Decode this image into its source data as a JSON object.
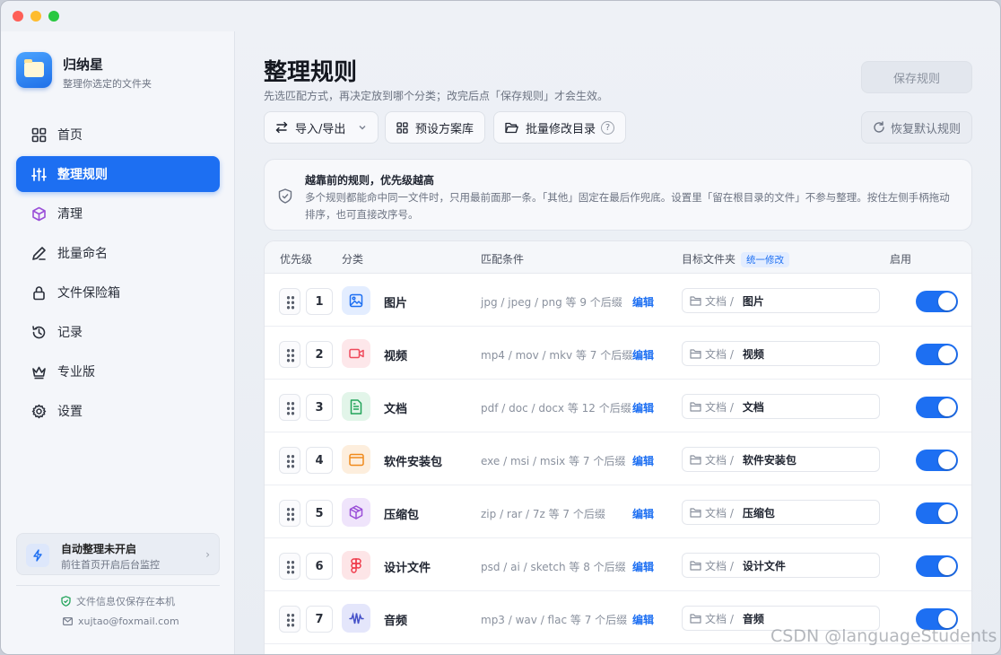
{
  "app": {
    "name": "归纳星",
    "subtitle": "整理你选定的文件夹"
  },
  "sidebar": {
    "items": [
      {
        "label": "首页",
        "icon": "grid-icon",
        "active": false
      },
      {
        "label": "整理规则",
        "icon": "sliders-icon",
        "active": true
      },
      {
        "label": "清理",
        "icon": "cube-icon",
        "active": false
      },
      {
        "label": "批量命名",
        "icon": "pen-icon",
        "active": false
      },
      {
        "label": "文件保险箱",
        "icon": "lock-icon",
        "active": false
      },
      {
        "label": "记录",
        "icon": "history-icon",
        "active": false
      },
      {
        "label": "专业版",
        "icon": "crown-icon",
        "active": false
      },
      {
        "label": "设置",
        "icon": "gear-icon",
        "active": false
      }
    ],
    "auto": {
      "title": "自动整理未开启",
      "subtitle": "前往首页开启后台监控"
    },
    "privacy": "文件信息仅保存在本机",
    "email": "xujtao@foxmail.com"
  },
  "main": {
    "title": "整理规则",
    "description": "先选匹配方式，再决定放到哪个分类；改完后点「保存规则」才会生效。",
    "save_label": "保存规则",
    "toolbar": {
      "import_export": "导入/导出",
      "presets": "预设方案库",
      "batch_dir": "批量修改目录",
      "help": "?",
      "restore": "恢复默认规则"
    },
    "notice": {
      "title": "越靠前的规则，优先级越高",
      "body": "多个规则都能命中同一文件时，只用最前面那一条。「其他」固定在最后作兜底。设置里「留在根目录的文件」不参与整理。按住左侧手柄拖动排序，也可直接改序号。"
    },
    "table": {
      "headers": {
        "priority": "优先级",
        "category": "分类",
        "condition": "匹配条件",
        "target": "目标文件夹",
        "unify": "统一修改",
        "enabled": "启用"
      },
      "edit_label": "编辑",
      "target_prefix": "文档 /",
      "rows": [
        {
          "priority": "1",
          "name": "图片",
          "icon": "image-icon",
          "color": "#1d6ff2",
          "bg": "#e3edff",
          "condition": "jpg / jpeg / png 等 9 个后缀",
          "target": "图片",
          "enabled": true
        },
        {
          "priority": "2",
          "name": "视频",
          "icon": "video-icon",
          "color": "#ef4a5c",
          "bg": "#fde7ea",
          "condition": "mp4 / mov / mkv 等 7 个后缀",
          "target": "视频",
          "enabled": true
        },
        {
          "priority": "3",
          "name": "文档",
          "icon": "document-icon",
          "color": "#22a45a",
          "bg": "#e2f5e9",
          "condition": "pdf / doc / docx 等 12 个后缀",
          "target": "文档",
          "enabled": true
        },
        {
          "priority": "4",
          "name": "软件安装包",
          "icon": "window-icon",
          "color": "#f08a1c",
          "bg": "#fdeedd",
          "condition": "exe / msi / msix 等 7 个后缀",
          "target": "软件安装包",
          "enabled": true
        },
        {
          "priority": "5",
          "name": "压缩包",
          "icon": "package-icon",
          "color": "#9a4fd8",
          "bg": "#efe4fb",
          "condition": "zip / rar / 7z 等 7 个后缀",
          "target": "压缩包",
          "enabled": true
        },
        {
          "priority": "6",
          "name": "设计文件",
          "icon": "figma-icon",
          "color": "#ef3b4b",
          "bg": "#fde5e7",
          "condition": "psd / ai / sketch 等 8 个后缀",
          "target": "设计文件",
          "enabled": true
        },
        {
          "priority": "7",
          "name": "音频",
          "icon": "audio-wave-icon",
          "color": "#4450c8",
          "bg": "#e4e6fb",
          "condition": "mp3 / wav / flac 等 7 个后缀",
          "target": "音频",
          "enabled": true
        }
      ]
    }
  },
  "watermark": "CSDN @languageStudents"
}
